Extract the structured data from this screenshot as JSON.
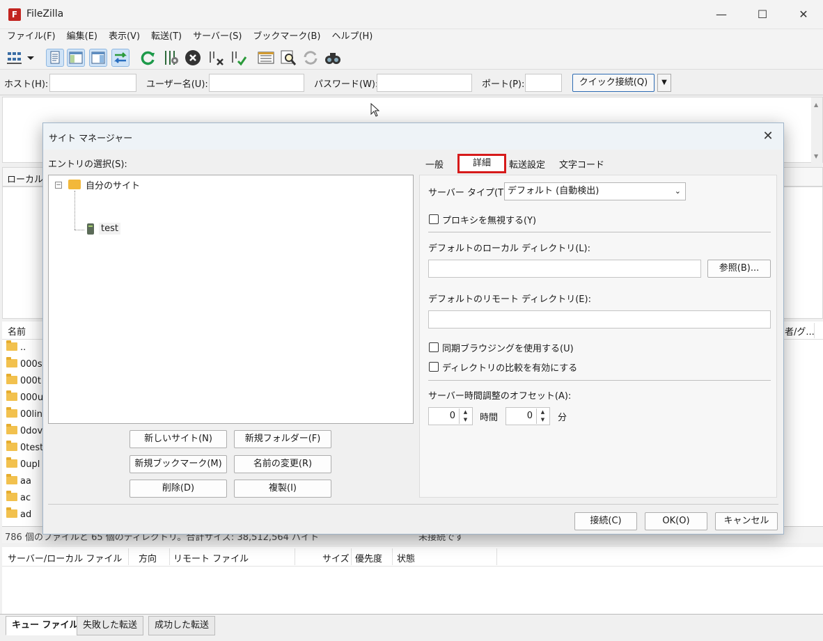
{
  "app": {
    "title": "FileZilla",
    "logo_letter": "F"
  },
  "window_controls": {
    "minimize": "—",
    "maximize": "☐",
    "close": "✕"
  },
  "menubar": [
    "ファイル(F)",
    "編集(E)",
    "表示(V)",
    "転送(T)",
    "サーバー(S)",
    "ブックマーク(B)",
    "ヘルプ(H)"
  ],
  "toolbar_icons": [
    "site-manager-icon",
    "dropdown-icon",
    "message-log-icon",
    "local-tree-icon",
    "remote-tree-icon",
    "transfer-queue-icon",
    "refresh-icon",
    "process-queue-icon",
    "cancel-icon",
    "disconnect-icon",
    "reconnect-icon",
    "directory-listing-filter-icon",
    "search-icon",
    "sync-browsing-icon",
    "find-files-icon"
  ],
  "quickconnect": {
    "host_label": "ホスト(H):",
    "user_label": "ユーザー名(U):",
    "password_label": "パスワード(W):",
    "port_label": "ポート(P):",
    "button": "クイック接続(Q)",
    "arrow": "▼"
  },
  "local": {
    "label": "ローカル"
  },
  "file_list": {
    "header_name": "名前",
    "header_owner": "者/グ...",
    "rows": [
      "..",
      "000s",
      "000t",
      "000u",
      "00lin",
      "0dov",
      "0test",
      "0upl",
      "aa",
      "ac",
      "ad"
    ]
  },
  "status_line": "786 個のファイルと 65 個のディレクトリ。合計サイズ: 38,512,564 バイト",
  "status_right": "未接続です",
  "queue": {
    "headers": [
      "サーバー/ローカル ファイル",
      "方向",
      "リモート ファイル",
      "サイズ",
      "優先度",
      "状態"
    ]
  },
  "bottom_tabs": [
    "キュー ファイル",
    "失敗した転送",
    "成功した転送"
  ],
  "dialog": {
    "title": "サイト マネージャー",
    "close": "✕",
    "entry_label": "エントリの選択(S):",
    "tree": {
      "root": "自分のサイト",
      "child": "test",
      "expander": "−"
    },
    "buttons": {
      "new_site": "新しいサイト(N)",
      "new_folder": "新規フォルダー(F)",
      "new_bookmark": "新規ブックマーク(M)",
      "rename": "名前の変更(R)",
      "delete": "削除(D)",
      "duplicate": "複製(I)"
    },
    "tabs": [
      "一般",
      "詳細",
      "転送設定",
      "文字コード"
    ],
    "active_tab": "詳細",
    "detail": {
      "server_type_label": "サーバー タイプ(T):",
      "server_type_value": "デフォルト (自動検出)",
      "bypass_proxy": "プロキシを無視する(Y)",
      "local_dir_label": "デフォルトのローカル ディレクトリ(L):",
      "browse": "参照(B)...",
      "remote_dir_label": "デフォルトのリモート ディレクトリ(E):",
      "sync_browsing": "同期ブラウジングを使用する(U)",
      "dir_compare": "ディレクトリの比較を有効にする",
      "offset_label": "サーバー時間調整のオフセット(A):",
      "hours_value": "0",
      "hours_unit": "時間",
      "minutes_value": "0",
      "minutes_unit": "分"
    },
    "footer": {
      "connect": "接続(C)",
      "ok": "OK(O)",
      "cancel": "キャンセル"
    }
  },
  "colors": {
    "highlight_border": "#d61a1a",
    "folder": "#f2c14e",
    "accent_blue": "#2d6bb3"
  }
}
